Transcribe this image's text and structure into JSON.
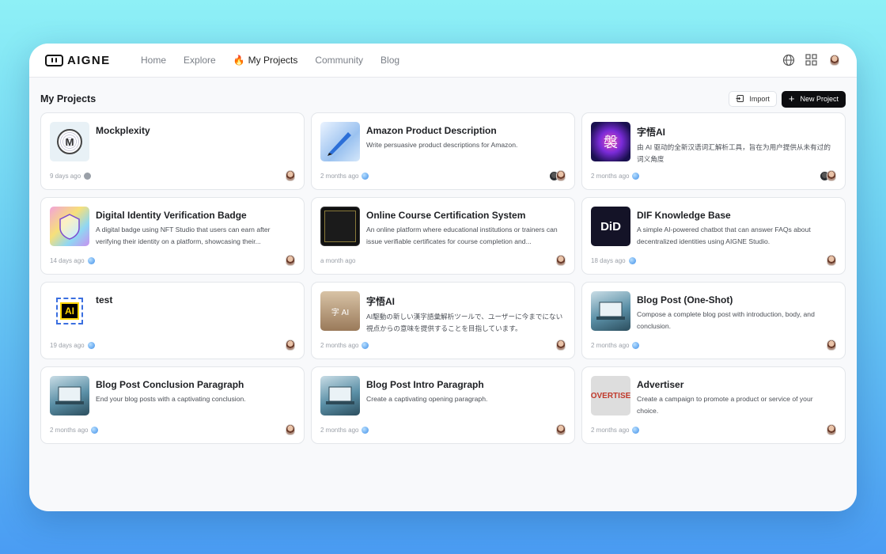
{
  "brand": {
    "name": "AIGNE"
  },
  "nav": [
    {
      "label": "Home",
      "active": false
    },
    {
      "label": "Explore",
      "active": false
    },
    {
      "label": "My Projects",
      "active": true
    },
    {
      "label": "Community",
      "active": false
    },
    {
      "label": "Blog",
      "active": false
    }
  ],
  "header": {
    "title": "My Projects",
    "import_label": "Import",
    "new_label": "New Project"
  },
  "projects": [
    {
      "title": "Mockplexity",
      "desc": "",
      "time": "9 days ago",
      "source": "github",
      "thumb": "M",
      "avatars": 1
    },
    {
      "title": "Amazon Product Description",
      "desc": "Write persuasive product descriptions for Amazon.",
      "time": "2 months ago",
      "source": "globe",
      "thumb": "",
      "avatars": 2
    },
    {
      "title": "字悟AI",
      "desc": "由 AI 驱动的全新汉语词汇解析工具，旨在为用户提供从未有过的词义角度",
      "time": "2 months ago",
      "source": "globe",
      "thumb": "褩",
      "avatars": 2
    },
    {
      "title": "Digital Identity Verification Badge",
      "desc": "A digital badge using NFT Studio that users can earn after verifying their identity on a platform, showcasing their...",
      "time": "14 days ago",
      "source": "globe",
      "thumb": "",
      "avatars": 1
    },
    {
      "title": "Online Course Certification System",
      "desc": "An online platform where educational institutions or trainers can issue verifiable certificates for course completion and...",
      "time": "a month ago",
      "source": "none",
      "thumb": "",
      "avatars": 1
    },
    {
      "title": "DIF Knowledge Base",
      "desc": "A simple AI-powered chatbot that can answer FAQs about decentralized identities using AIGNE Studio.",
      "time": "18 days ago",
      "source": "globe",
      "thumb": "DiD",
      "avatars": 1
    },
    {
      "title": "test",
      "desc": "",
      "time": "19 days ago",
      "source": "globe",
      "thumb": "AI",
      "avatars": 1
    },
    {
      "title": "字悟AI",
      "desc": "AI駆動の新しい漢字語彙解析ツールで、ユーザーに今までにない視点からの意味を提供することを目指しています。",
      "time": "2 months ago",
      "source": "globe",
      "thumb": "字 AI",
      "avatars": 1
    },
    {
      "title": "Blog Post (One-Shot)",
      "desc": "Compose a complete blog post with introduction, body, and conclusion.",
      "time": "2 months ago",
      "source": "globe",
      "thumb": "",
      "avatars": 1
    },
    {
      "title": "Blog Post Conclusion Paragraph",
      "desc": "End your blog posts with a captivating conclusion.",
      "time": "2 months ago",
      "source": "globe",
      "thumb": "",
      "avatars": 1
    },
    {
      "title": "Blog Post Intro Paragraph",
      "desc": "Create a captivating opening paragraph.",
      "time": "2 months ago",
      "source": "globe",
      "thumb": "",
      "avatars": 1
    },
    {
      "title": "Advertiser",
      "desc": "Create a campaign to promote a product or service of your choice.",
      "time": "2 months ago",
      "source": "globe",
      "thumb": "OVERTISE",
      "avatars": 1
    }
  ]
}
